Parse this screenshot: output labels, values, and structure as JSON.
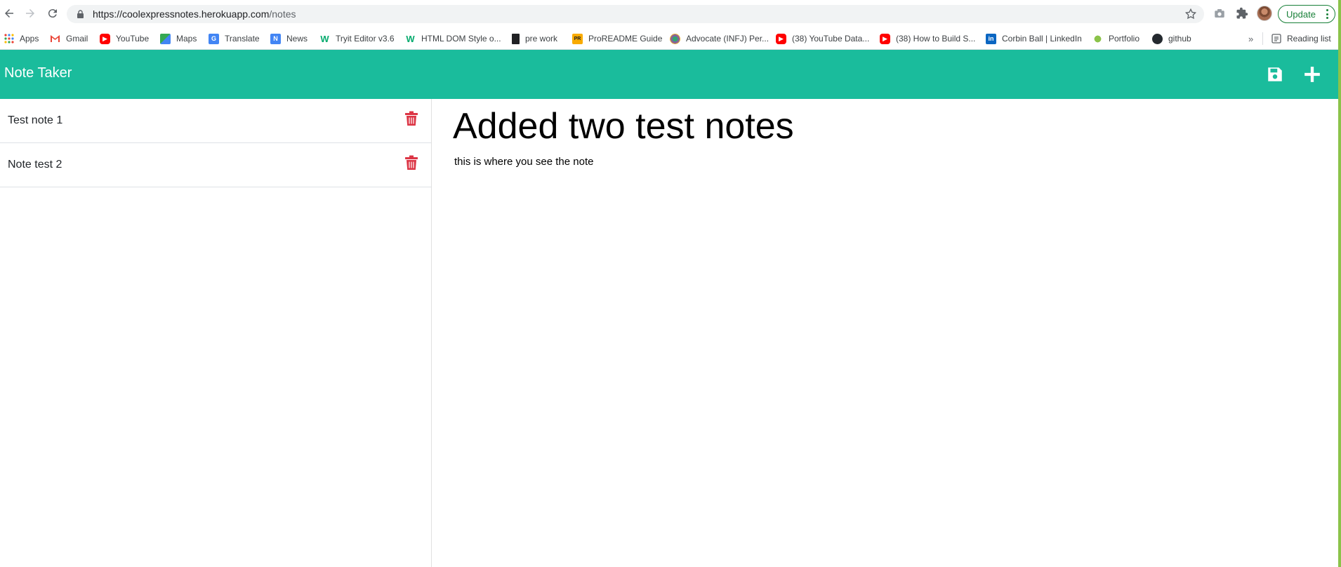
{
  "browser": {
    "url_host": "https://coolexpressnotes.herokuapp.com",
    "url_path": "/notes",
    "update_label": "Update"
  },
  "bookmarks": [
    {
      "label": "Apps",
      "icon": "apps-grid-icon"
    },
    {
      "label": "Gmail",
      "icon": "gmail-icon"
    },
    {
      "label": "YouTube",
      "icon": "youtube-icon"
    },
    {
      "label": "Maps",
      "icon": "maps-icon"
    },
    {
      "label": "Translate",
      "icon": "translate-icon"
    },
    {
      "label": "News",
      "icon": "news-icon"
    },
    {
      "label": "Tryit Editor v3.6",
      "icon": "w3schools-icon"
    },
    {
      "label": "HTML DOM Style o...",
      "icon": "w3schools-icon"
    },
    {
      "label": "pre work",
      "icon": "book-icon"
    },
    {
      "label": "ProREADME Guide",
      "icon": "proreadme-icon"
    },
    {
      "label": "Advocate (INFJ) Per...",
      "icon": "16personalities-icon"
    },
    {
      "label": "(38) YouTube Data...",
      "icon": "youtube-icon"
    },
    {
      "label": "(38) How to Build S...",
      "icon": "youtube-icon"
    },
    {
      "label": "Corbin Ball | LinkedIn",
      "icon": "linkedin-icon"
    },
    {
      "label": "Portfolio",
      "icon": "portfolio-icon"
    },
    {
      "label": "github",
      "icon": "github-icon"
    }
  ],
  "bookmarks_more": "»",
  "reading_list": "Reading list",
  "app": {
    "title": "Note Taker",
    "save_icon": "floppy-disk-icon",
    "new_icon": "plus-icon",
    "accent_color": "#1abc9c",
    "delete_color": "#dc3545"
  },
  "notes": [
    {
      "title": "Test note 1"
    },
    {
      "title": "Note test 2"
    }
  ],
  "editor": {
    "title": "Added two test notes",
    "text": "this is where you see the note"
  }
}
